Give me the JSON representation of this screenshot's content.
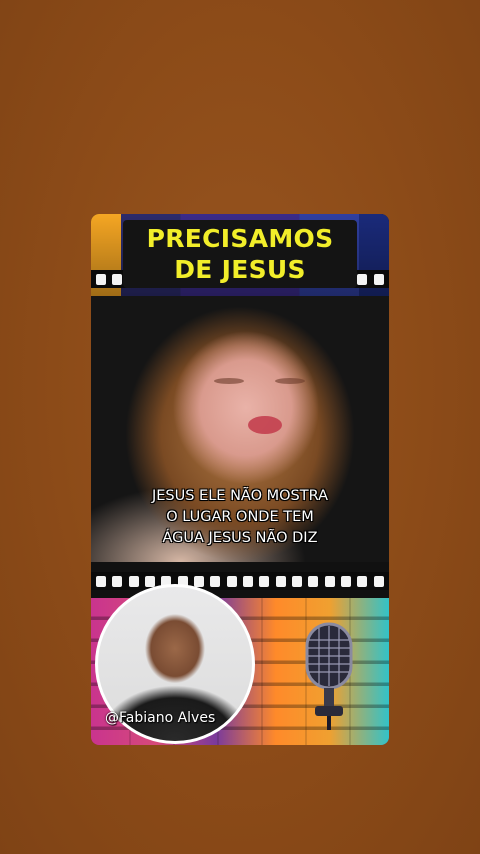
{
  "colors": {
    "background": "#8c4b18",
    "title_text": "#f2ee2a",
    "title_box": "#141414",
    "subtitle_text": "#ffffff"
  },
  "title": {
    "line1": "PRECISAMOS",
    "line2": "DE JESUS"
  },
  "video": {
    "subtitle_lines": [
      "JESUS ELE NÃO MOSTRA",
      "O LUGAR ONDE TEM",
      "ÁGUA JESUS NÃO DIZ"
    ]
  },
  "overlay": {
    "handle": "@Fabiano Alves"
  },
  "icons": {
    "microphone": "microphone-icon"
  }
}
